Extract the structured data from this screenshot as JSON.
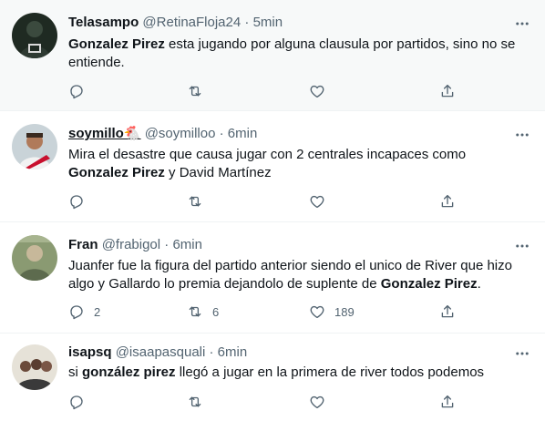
{
  "tweets": [
    {
      "name": "Telasampo",
      "handle": "@RetinaFloja24",
      "dot": "·",
      "time": "5min",
      "text_parts": [
        "",
        "Gonzalez Pirez",
        " esta jugando por alguna clausula por partidos, sino no se entiende."
      ],
      "replies": "",
      "retweets": "",
      "likes": ""
    },
    {
      "name": "soymillo🐔",
      "handle": "@soymilloo",
      "dot": "·",
      "time": "6min",
      "text_parts": [
        "Mira el desastre que causa jugar con 2 centrales incapaces como ",
        "Gonzalez Pirez",
        " y David Martínez"
      ],
      "replies": "",
      "retweets": "",
      "likes": ""
    },
    {
      "name": "Fran",
      "handle": "@frabigol",
      "dot": "·",
      "time": "6min",
      "text_parts": [
        "Juanfer fue la figura del partido anterior siendo el unico de River que hizo algo y Gallardo lo premia dejandolo de suplente de ",
        "Gonzalez Pirez",
        "."
      ],
      "replies": "2",
      "retweets": "6",
      "likes": "189"
    },
    {
      "name": "isapsq",
      "handle": "@isaapasquali",
      "dot": "·",
      "time": "6min",
      "text_parts": [
        "si ",
        "gonzález pirez",
        " llegó a jugar en la primera de river todos podemos"
      ],
      "replies": "",
      "retweets": "",
      "likes": ""
    }
  ],
  "icons": {
    "more": "more-horizontal-icon",
    "reply": "reply-icon",
    "retweet": "retweet-icon",
    "like": "heart-icon",
    "share": "share-icon"
  },
  "colors": {
    "text": "#0f1419",
    "secondary": "#536471",
    "hover_bg": "#f7f9f9",
    "divider": "#eff3f4"
  }
}
